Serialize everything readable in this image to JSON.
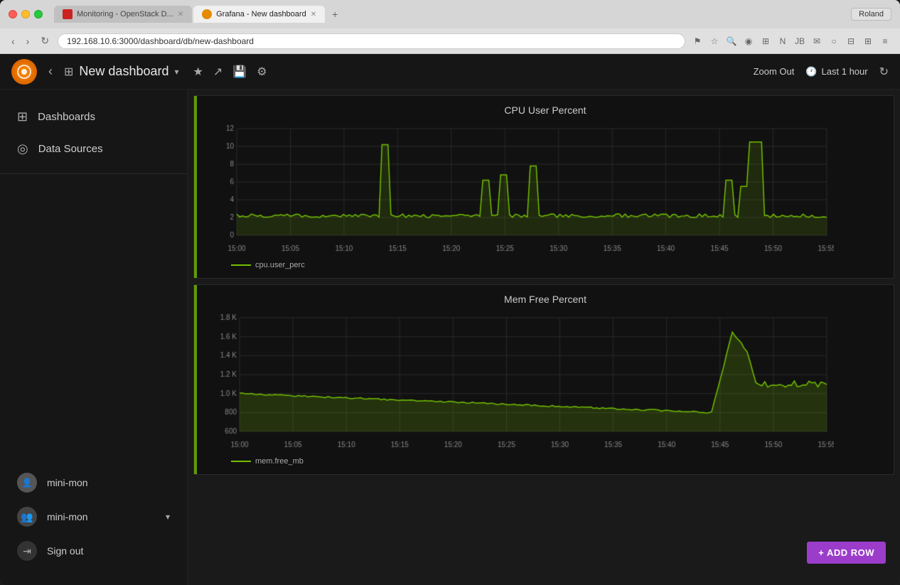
{
  "browser": {
    "tabs": [
      {
        "id": "monitoring",
        "label": "Monitoring - OpenStack D...",
        "type": "monitoring",
        "active": false
      },
      {
        "id": "grafana",
        "label": "Grafana - New dashboard",
        "type": "grafana",
        "active": true
      }
    ],
    "address": "192.168.10.6:3000/dashboard/db/new-dashboard",
    "user": "Roland"
  },
  "header": {
    "title": "New dashboard",
    "zoom_out": "Zoom Out",
    "time_range": "Last 1 hour"
  },
  "sidebar": {
    "items": [
      {
        "id": "dashboards",
        "label": "Dashboards",
        "icon": "⊞"
      },
      {
        "id": "data-sources",
        "label": "Data Sources",
        "icon": "◎"
      }
    ],
    "user": {
      "profile": "mini-mon",
      "admin": "mini-mon",
      "signout": "Sign out"
    }
  },
  "panels": [
    {
      "id": "cpu",
      "title": "CPU User Percent",
      "legend": "cpu.user_perc",
      "y_labels": [
        "12",
        "10",
        "8",
        "6",
        "4",
        "2",
        "0"
      ],
      "x_labels": [
        "15:00",
        "15:05",
        "15:10",
        "15:15",
        "15:20",
        "15:25",
        "15:30",
        "15:35",
        "15:40",
        "15:45",
        "15:50",
        "15:55"
      ]
    },
    {
      "id": "mem",
      "title": "Mem Free Percent",
      "legend": "mem.free_mb",
      "y_labels": [
        "1.8 K",
        "1.6 K",
        "1.4 K",
        "1.2 K",
        "1.0 K",
        "800",
        "600"
      ],
      "x_labels": [
        "15:00",
        "15:05",
        "15:10",
        "15:15",
        "15:20",
        "15:25",
        "15:30",
        "15:35",
        "15:40",
        "15:45",
        "15:50",
        "15:55"
      ]
    }
  ],
  "add_row": "+ ADD ROW"
}
